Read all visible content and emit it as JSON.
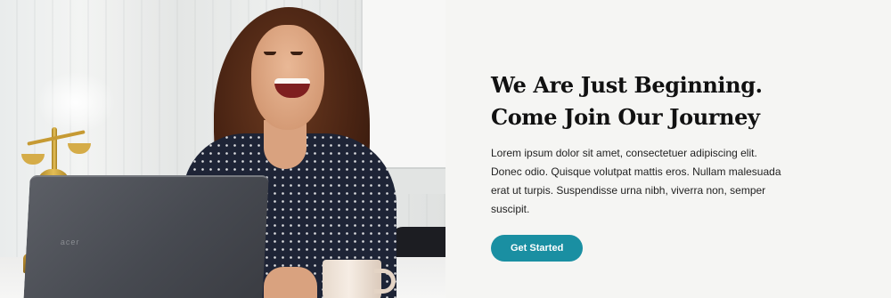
{
  "hero": {
    "heading_line1": "We Are Just Beginning.",
    "heading_line2": "Come Join Our Journey",
    "body": "Lorem ipsum dolor sit amet, consectetuer adipiscing elit. Donec odio. Quisque volutpat mattis eros. Nullam malesuada erat ut turpis. Suspendisse urna nibh, viverra non, semper suscipit.",
    "cta_label": "Get Started"
  },
  "photo": {
    "laptop_brand": "acer"
  },
  "colors": {
    "accent": "#1a8fa2",
    "background": "#f5f5f3",
    "heading": "#111111",
    "body_text": "#222222"
  }
}
